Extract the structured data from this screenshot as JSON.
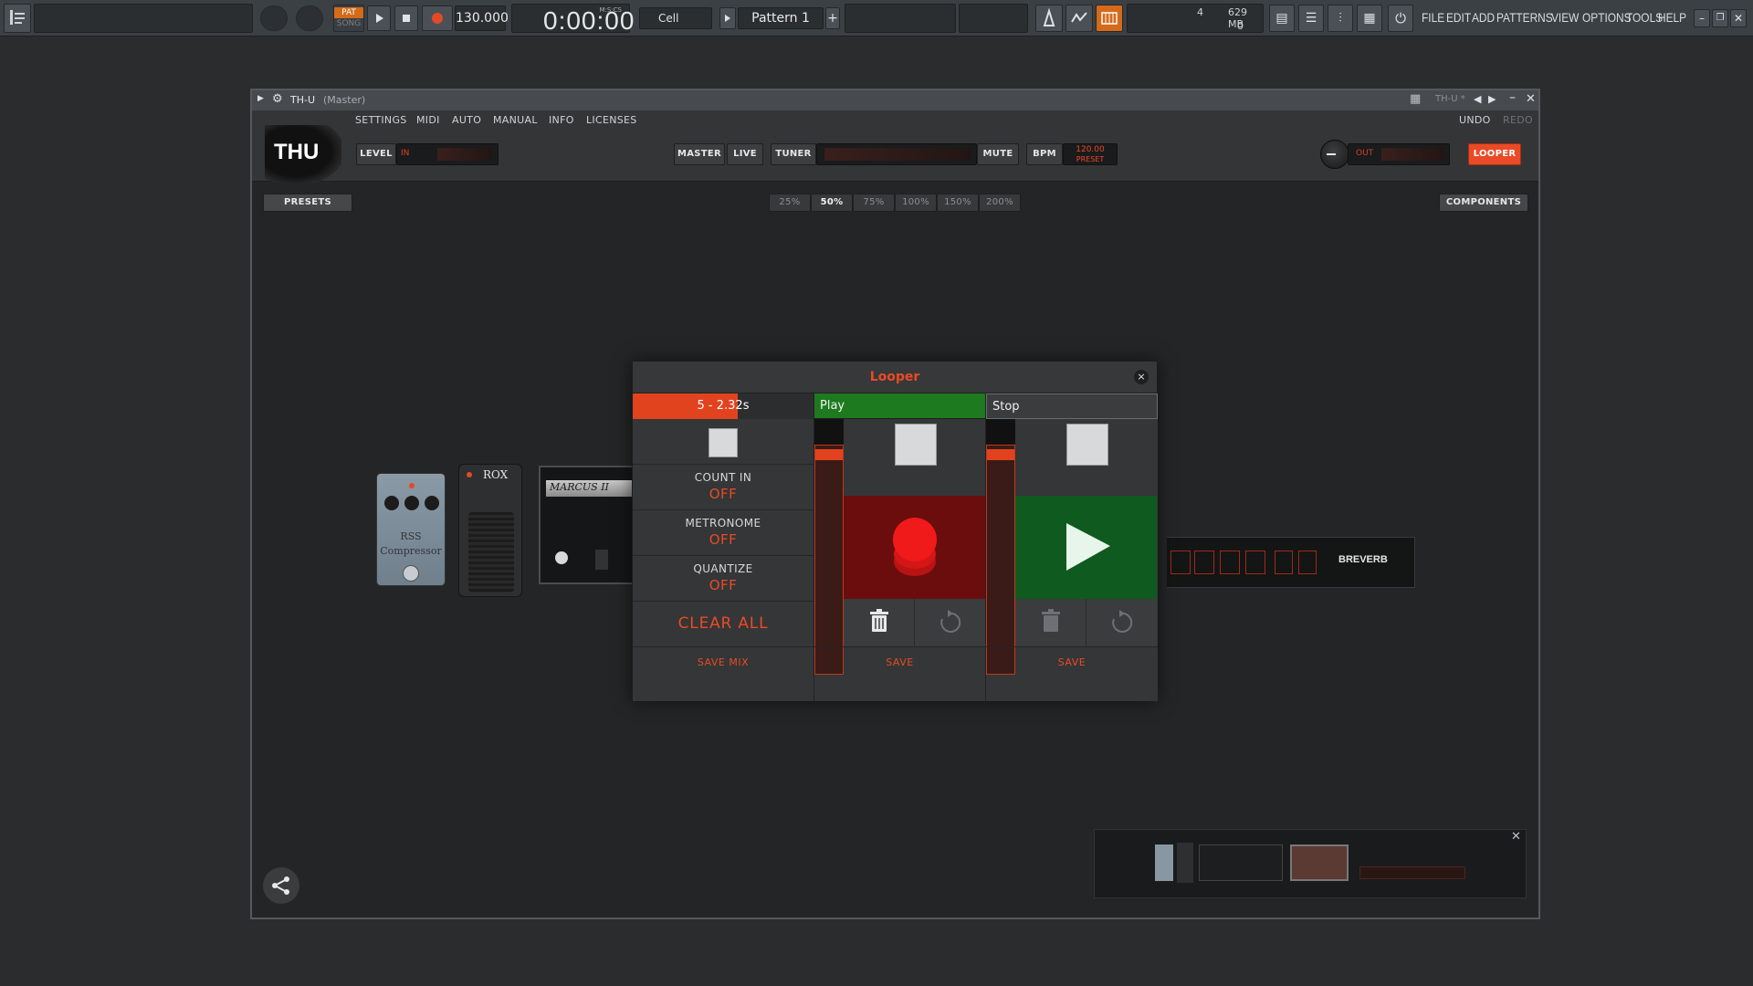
{
  "fl": {
    "tempo": "130.000",
    "time": "0:00:00",
    "time_small": "M:S:CS",
    "pat_label": "PAT",
    "song_label": "SONG",
    "snap": "Cell",
    "pattern": "Pattern 1",
    "cpu_value": "4",
    "mem_value": "629 MB",
    "poly_value": "0",
    "menu": [
      "FILE",
      "EDIT",
      "ADD",
      "PATTERNS",
      "VIEW",
      "OPTIONS",
      "TOOLS",
      "HELP"
    ]
  },
  "plugin": {
    "window_title": "TH-U",
    "window_subtitle": "(Master)",
    "preset_name": "TH-U *",
    "menu": [
      "SETTINGS",
      "MIDI",
      "AUTO",
      "MANUAL",
      "INFO",
      "LICENSES"
    ],
    "undo": "UNDO",
    "redo": "REDO",
    "logo": "THU",
    "level_label": "LEVEL",
    "in_label": "IN",
    "master_label": "MASTER",
    "live_label": "LIVE",
    "tuner_label": "TUNER",
    "mute_label": "MUTE",
    "bpm_label": "BPM",
    "bpm_value": "120.00",
    "bpm_source": "PRESET",
    "out_label": "OUT",
    "looper_label": "LOOPER",
    "presets_label": "PRESETS",
    "components_label": "COMPONENTS",
    "zoom_options": [
      "25%",
      "50%",
      "75%",
      "100%",
      "150%",
      "200%"
    ],
    "zoom_selected": "50%",
    "pedals": {
      "compressor_name": "RSS",
      "compressor_sub": "Compressor",
      "wah_name": "ROX",
      "amp_name": "MARCUS II",
      "reverb_name": "BREVERB"
    }
  },
  "looper": {
    "title": "Looper",
    "close_label": "×",
    "length_display": "5 - 2.32s",
    "length_progress": 0.58,
    "track1_state": "Play",
    "track2_state": "Stop",
    "count_in_label": "COUNT IN",
    "count_in_value": "OFF",
    "metronome_label": "METRONOME",
    "metronome_value": "OFF",
    "quantize_label": "QUANTIZE",
    "quantize_value": "OFF",
    "clear_all_label": "CLEAR ALL",
    "save_mix_label": "SAVE MIX",
    "track1_save_label": "SAVE",
    "track2_save_label": "SAVE"
  },
  "colors": {
    "accent": "#ea4a26",
    "play_green": "#1d7a1e",
    "record_red": "#6b0d0d",
    "play_panel": "#0f5a1f"
  }
}
